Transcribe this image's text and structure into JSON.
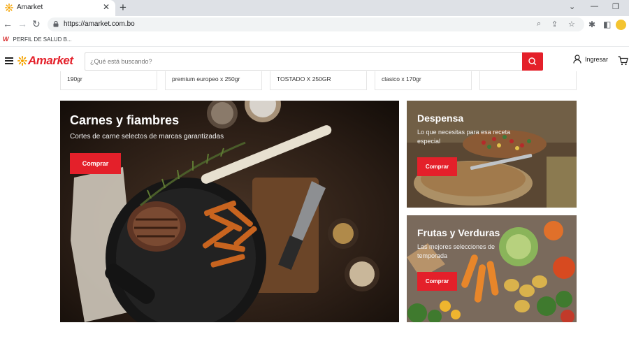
{
  "browser": {
    "tab_title": "Amarket",
    "url": "https://amarket.com.bo",
    "bookmark_label": "PERFIL DE SALUD B...",
    "bookmark_logo": "W"
  },
  "header": {
    "logo_text": "Amarket",
    "search_placeholder": "¿Qué está buscando?",
    "login_label": "Ingresar"
  },
  "products": [
    {
      "name": "190gr"
    },
    {
      "name": "premium europeo x 250gr"
    },
    {
      "name": "TOSTADO X 250GR"
    },
    {
      "name": "clasico x 170gr"
    },
    {
      "name": ""
    }
  ],
  "banners": {
    "meat": {
      "title": "Carnes y fiambres",
      "subtitle": "Cortes de carne selectos de marcas garantizadas",
      "button": "Comprar"
    },
    "pantry": {
      "title": "Despensa",
      "subtitle": "Lo que necesitas para esa receta especial",
      "button": "Comprar"
    },
    "produce": {
      "title": "Frutas y Verduras",
      "subtitle": "Las mejores selecciones de temporada",
      "button": "Comprar"
    }
  },
  "colors": {
    "brand": "#e4202a",
    "chrome_bg": "#dee1e6"
  }
}
